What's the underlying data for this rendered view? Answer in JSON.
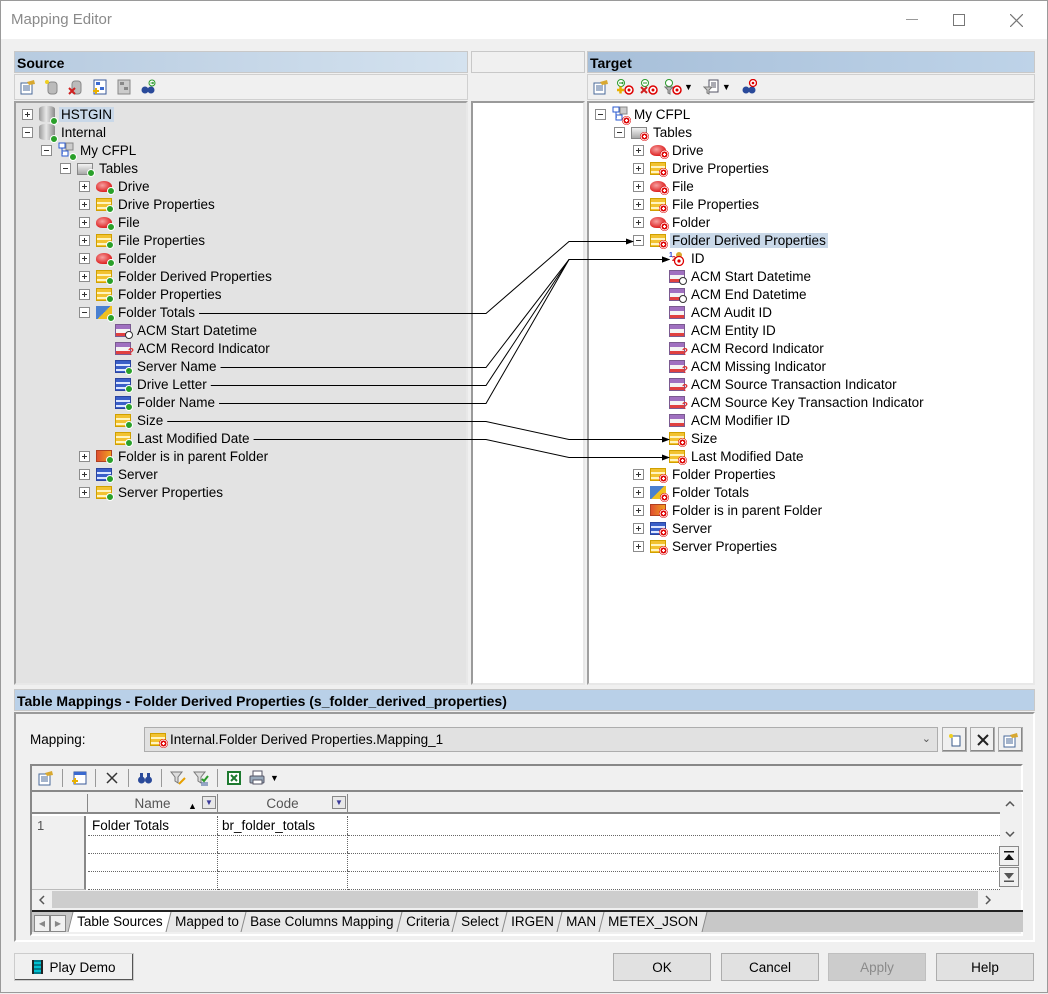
{
  "window": {
    "title": "Mapping Editor"
  },
  "source": {
    "header": "Source",
    "toolbar": [
      "properties-icon",
      "new-datasource-icon",
      "delete-datasource-icon",
      "add-model-icon",
      "model-disabled-icon",
      "find-icon"
    ],
    "tree": [
      {
        "id": "hstgin",
        "label": "HSTGIN",
        "level": 0,
        "expander": "plus",
        "icon": "database",
        "selected": true
      },
      {
        "id": "internal",
        "label": "Internal",
        "level": 0,
        "expander": "minus",
        "icon": "database"
      },
      {
        "id": "my-cfpl",
        "label": "My CFPL",
        "level": 1,
        "expander": "minus",
        "icon": "model"
      },
      {
        "id": "tables",
        "label": "Tables",
        "level": 2,
        "expander": "minus",
        "icon": "folder"
      },
      {
        "id": "drive",
        "label": "Drive",
        "level": 3,
        "expander": "plus",
        "icon": "entity"
      },
      {
        "id": "drive-properties",
        "label": "Drive Properties",
        "level": 3,
        "expander": "plus",
        "icon": "table-yellow"
      },
      {
        "id": "file",
        "label": "File",
        "level": 3,
        "expander": "plus",
        "icon": "entity"
      },
      {
        "id": "file-properties",
        "label": "File Properties",
        "level": 3,
        "expander": "plus",
        "icon": "table-yellow"
      },
      {
        "id": "folder",
        "label": "Folder",
        "level": 3,
        "expander": "plus",
        "icon": "entity"
      },
      {
        "id": "folder-derived-properties",
        "label": "Folder Derived Properties",
        "level": 3,
        "expander": "plus",
        "icon": "table-yellow"
      },
      {
        "id": "folder-properties",
        "label": "Folder Properties",
        "level": 3,
        "expander": "plus",
        "icon": "table-yellow"
      },
      {
        "id": "folder-totals",
        "label": "Folder Totals",
        "level": 3,
        "expander": "minus",
        "icon": "view"
      },
      {
        "id": "acm-start-datetime",
        "label": "ACM Start Datetime",
        "level": 4,
        "icon": "column-clock"
      },
      {
        "id": "acm-record-indicator",
        "label": "ACM Record Indicator",
        "level": 4,
        "icon": "column-question"
      },
      {
        "id": "server-name",
        "label": "Server Name",
        "level": 4,
        "icon": "column-blue"
      },
      {
        "id": "drive-letter",
        "label": "Drive Letter",
        "level": 4,
        "icon": "column-blue"
      },
      {
        "id": "folder-name",
        "label": "Folder Name",
        "level": 4,
        "icon": "column-blue"
      },
      {
        "id": "size",
        "label": "Size",
        "level": 4,
        "icon": "column-yellow"
      },
      {
        "id": "last-modified-date",
        "label": "Last Modified Date",
        "level": 4,
        "icon": "column-yellow"
      },
      {
        "id": "folder-is-in-parent-folder",
        "label": "Folder is in parent Folder",
        "level": 3,
        "expander": "plus",
        "icon": "table-orange"
      },
      {
        "id": "server",
        "label": "Server",
        "level": 3,
        "expander": "plus",
        "icon": "table-blue"
      },
      {
        "id": "server-properties",
        "label": "Server Properties",
        "level": 3,
        "expander": "plus",
        "icon": "table-yellow"
      }
    ]
  },
  "target": {
    "header": "Target",
    "toolbar": [
      "properties-icon",
      "add-mapping-icon",
      "delete-mapping-icon",
      "mapping-menu-icon",
      "filter-menu-icon",
      "find-target-icon"
    ],
    "tree": [
      {
        "id": "my-cfpl",
        "label": "My CFPL",
        "level": 0,
        "expander": "minus",
        "icon": "model"
      },
      {
        "id": "tables",
        "label": "Tables",
        "level": 1,
        "expander": "minus",
        "icon": "folder"
      },
      {
        "id": "drive",
        "label": "Drive",
        "level": 2,
        "expander": "plus",
        "icon": "entity"
      },
      {
        "id": "drive-properties",
        "label": "Drive Properties",
        "level": 2,
        "expander": "plus",
        "icon": "table-yellow"
      },
      {
        "id": "file",
        "label": "File",
        "level": 2,
        "expander": "plus",
        "icon": "entity"
      },
      {
        "id": "file-properties",
        "label": "File Properties",
        "level": 2,
        "expander": "plus",
        "icon": "table-yellow"
      },
      {
        "id": "folder",
        "label": "Folder",
        "level": 2,
        "expander": "plus",
        "icon": "entity"
      },
      {
        "id": "folder-derived-properties",
        "label": "Folder Derived Properties",
        "level": 2,
        "expander": "minus",
        "icon": "table-yellow",
        "selected": true
      },
      {
        "id": "id",
        "label": "ID",
        "level": 3,
        "icon": "key"
      },
      {
        "id": "acm-start-datetime",
        "label": "ACM Start Datetime",
        "level": 3,
        "icon": "column-clock"
      },
      {
        "id": "acm-end-datetime",
        "label": "ACM End Datetime",
        "level": 3,
        "icon": "column-clock"
      },
      {
        "id": "acm-audit-id",
        "label": "ACM Audit ID",
        "level": 3,
        "icon": "column-purple"
      },
      {
        "id": "acm-entity-id",
        "label": "ACM Entity ID",
        "level": 3,
        "icon": "column-purple"
      },
      {
        "id": "acm-record-indicator",
        "label": "ACM Record Indicator",
        "level": 3,
        "icon": "column-question"
      },
      {
        "id": "acm-missing-indicator",
        "label": "ACM Missing Indicator",
        "level": 3,
        "icon": "column-question"
      },
      {
        "id": "acm-source-transaction-indicator",
        "label": "ACM Source Transaction Indicator",
        "level": 3,
        "icon": "column-question"
      },
      {
        "id": "acm-source-key-transaction-indicator",
        "label": "ACM Source Key Transaction Indicator",
        "level": 3,
        "icon": "column-question"
      },
      {
        "id": "acm-modifier-id",
        "label": "ACM Modifier ID",
        "level": 3,
        "icon": "column-purple"
      },
      {
        "id": "size",
        "label": "Size",
        "level": 3,
        "icon": "column-yellow"
      },
      {
        "id": "last-modified-date",
        "label": "Last Modified Date",
        "level": 3,
        "icon": "column-yellow"
      },
      {
        "id": "folder-properties",
        "label": "Folder Properties",
        "level": 2,
        "expander": "plus",
        "icon": "table-yellow"
      },
      {
        "id": "folder-totals",
        "label": "Folder Totals",
        "level": 2,
        "expander": "plus",
        "icon": "view"
      },
      {
        "id": "folder-is-in-parent-folder",
        "label": "Folder is in parent Folder",
        "level": 2,
        "expander": "plus",
        "icon": "table-orange"
      },
      {
        "id": "server",
        "label": "Server",
        "level": 2,
        "expander": "plus",
        "icon": "table-blue"
      },
      {
        "id": "server-properties",
        "label": "Server Properties",
        "level": 2,
        "expander": "plus",
        "icon": "table-yellow"
      }
    ]
  },
  "mappings": [
    {
      "from": "folder-totals",
      "to": "folder-derived-properties"
    },
    {
      "from": "server-name",
      "to": "id"
    },
    {
      "from": "drive-letter",
      "to": "id"
    },
    {
      "from": "folder-name",
      "to": "id"
    },
    {
      "from": "size",
      "to": "size"
    },
    {
      "from": "last-modified-date",
      "to": "last-modified-date"
    }
  ],
  "table_mappings": {
    "header": "Table Mappings - Folder Derived Properties (s_folder_derived_properties)",
    "mapping_label": "Mapping:",
    "mapping_value": "Internal.Folder Derived Properties.Mapping_1",
    "grid": {
      "columns": [
        {
          "label": "Name",
          "sort": "ascending"
        },
        {
          "label": "Code"
        }
      ],
      "rows": [
        {
          "num": "1",
          "name": "Folder Totals",
          "code": "br_folder_totals"
        },
        {
          "num": "",
          "name": "",
          "code": ""
        },
        {
          "num": "",
          "name": "",
          "code": ""
        },
        {
          "num": "",
          "name": "",
          "code": ""
        }
      ]
    },
    "tabs": [
      "Table Sources",
      "Mapped to",
      "Base Columns Mapping",
      "Criteria",
      "Select",
      "IRGEN",
      "MAN",
      "METEX_JSON"
    ],
    "active_tab": "Table Sources"
  },
  "buttons": {
    "play_demo": "Play Demo",
    "ok": "OK",
    "cancel": "Cancel",
    "apply": "Apply",
    "help": "Help"
  }
}
